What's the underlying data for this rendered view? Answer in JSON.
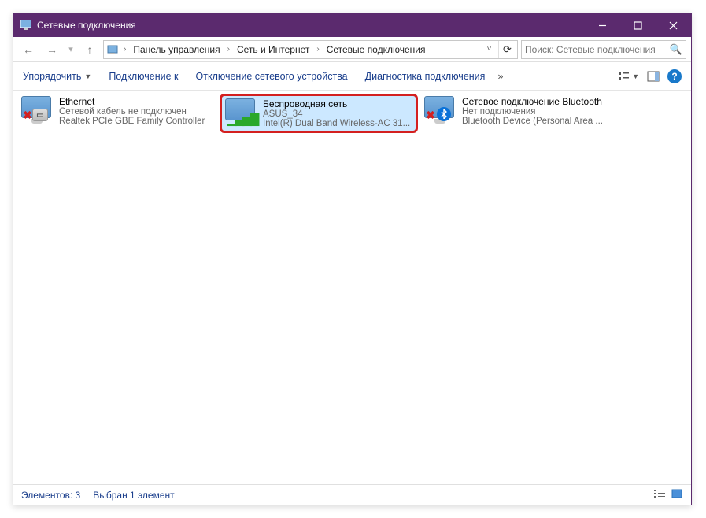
{
  "window": {
    "title": "Сетевые подключения"
  },
  "breadcrumbs": {
    "items": [
      "Панель управления",
      "Сеть и Интернет",
      "Сетевые подключения"
    ]
  },
  "search": {
    "placeholder": "Поиск: Сетевые подключения"
  },
  "toolbar": {
    "organize": "Упорядочить",
    "connect_to": "Подключение к",
    "disable": "Отключение сетевого устройства",
    "diagnostics": "Диагностика подключения",
    "more": "»"
  },
  "connections": [
    {
      "name": "Ethernet",
      "status": "Сетевой кабель не подключен",
      "device": "Realtek PCIe GBE Family Controller",
      "overlay": "x_plug",
      "selected": false
    },
    {
      "name": "Беспроводная сеть",
      "status": "ASUS_34",
      "device": "Intel(R) Dual Band Wireless-AC 31...",
      "overlay": "bars",
      "selected": true
    },
    {
      "name": "Сетевое подключение Bluetooth",
      "status": "Нет подключения",
      "device": "Bluetooth Device (Personal Area ...",
      "overlay": "x_bt",
      "selected": false
    }
  ],
  "statusbar": {
    "count": "Элементов: 3",
    "selected": "Выбран 1 элемент"
  }
}
